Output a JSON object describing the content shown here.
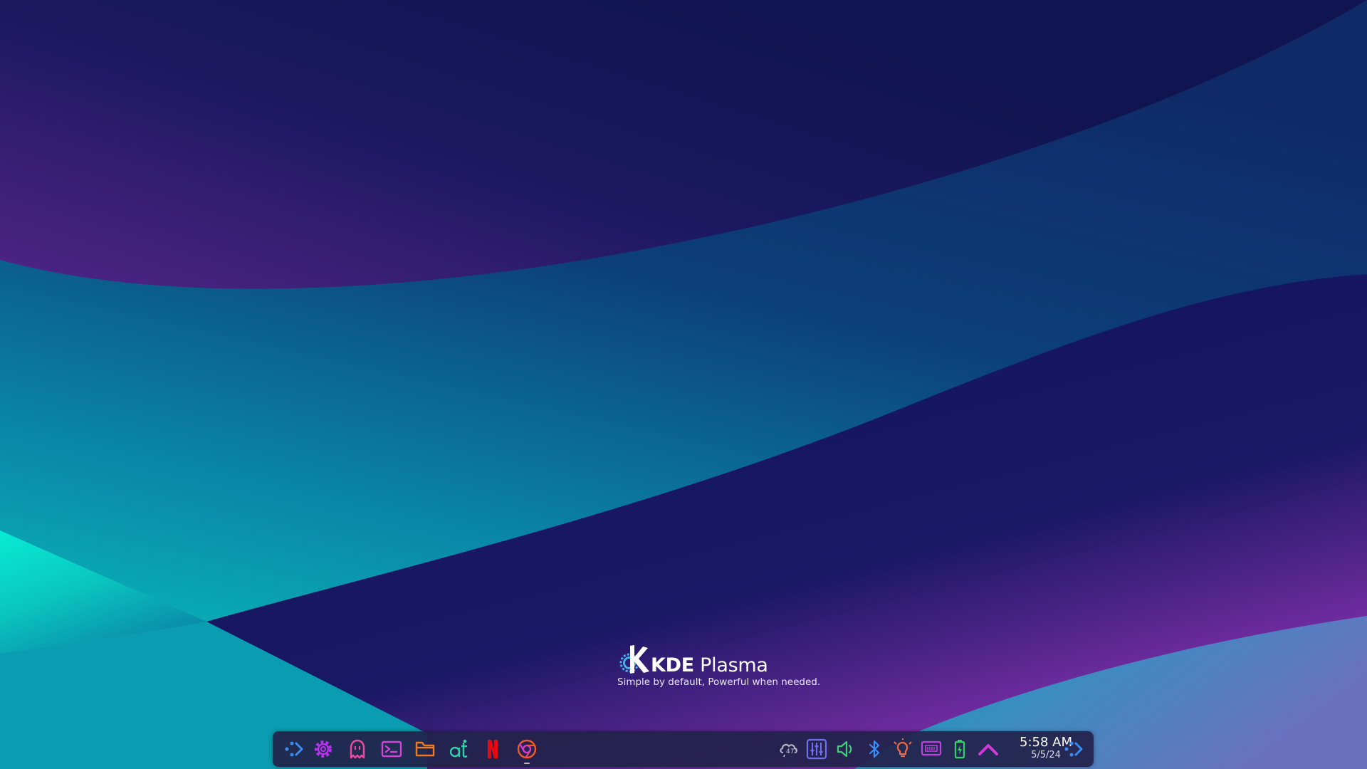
{
  "desktop": {
    "logo": {
      "brand_bold": "KDE",
      "brand_light": " Plasma",
      "tagline": "Simple by default, Powerful when needed."
    }
  },
  "taskbar": {
    "launchers": [
      {
        "name": "application-launcher",
        "icon": "app-launcher-icon",
        "color": "#3b8cf0"
      },
      {
        "name": "system-settings",
        "icon": "gear-icon",
        "color": "#b533e8"
      },
      {
        "name": "ghost-app",
        "icon": "ghost-icon",
        "color": "#ee4aa0"
      },
      {
        "name": "terminal",
        "icon": "terminal-icon",
        "color": "#d045d8"
      },
      {
        "name": "file-manager",
        "icon": "folder-icon",
        "color": "#f07a1e"
      },
      {
        "name": "qbittorrent",
        "icon": "qbittorrent-icon",
        "color": "#2ed4a8"
      },
      {
        "name": "netflix",
        "icon": "netflix-icon",
        "color": "#e50914"
      },
      {
        "name": "chrome",
        "icon": "chrome-icon",
        "color": "#f05a28",
        "active": true
      }
    ],
    "tray": {
      "weather_temp": "47°",
      "items": [
        {
          "name": "weather",
          "icon": "cloud-rain-icon",
          "color": "#b8b8c8"
        },
        {
          "name": "mixer",
          "icon": "equalizer-icon",
          "color": "#6f6ff0"
        },
        {
          "name": "volume",
          "icon": "speaker-icon",
          "color": "#3fcf7a"
        },
        {
          "name": "bluetooth",
          "icon": "bluetooth-icon",
          "color": "#3a8ef5"
        },
        {
          "name": "night-color",
          "icon": "bulb-icon",
          "color": "#f06a4a"
        },
        {
          "name": "display",
          "icon": "monitor-icon",
          "color": "#c040e0"
        },
        {
          "name": "battery",
          "icon": "battery-icon",
          "color": "#34d068"
        },
        {
          "name": "show-hidden",
          "icon": "chevron-up-icon",
          "color": "#d03ad8"
        }
      ],
      "clock": {
        "time": "5:58 AM",
        "date": "5/5/24"
      }
    }
  }
}
